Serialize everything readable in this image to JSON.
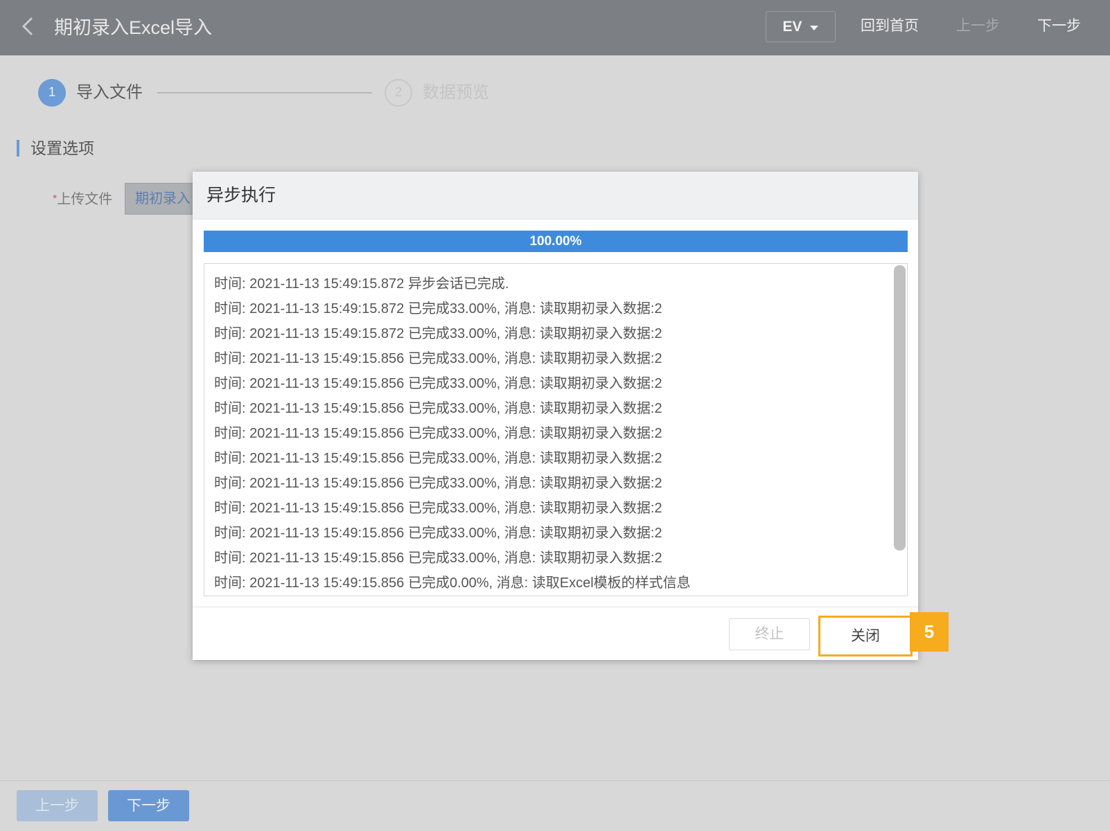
{
  "header": {
    "title": "期初录入Excel导入",
    "scenario_select": "EV",
    "home_label": "回到首页",
    "prev_label": "上一步",
    "next_label": "下一步"
  },
  "steps": [
    {
      "number": "1",
      "label": "导入文件",
      "state": "active"
    },
    {
      "number": "2",
      "label": "数据预览",
      "state": "inactive"
    }
  ],
  "section": {
    "title": "设置选项",
    "upload_required_mark": "*",
    "upload_label": "上传文件",
    "upload_file_value": "期初录入"
  },
  "footer": {
    "prev_label": "上一步",
    "next_label": "下一步"
  },
  "modal": {
    "title": "异步执行",
    "progress_percent": 100,
    "progress_text": "100.00%",
    "log_lines": [
      "时间: 2021-11-13 15:49:15.872 异步会话已完成.",
      "时间: 2021-11-13 15:49:15.872 已完成33.00%, 消息: 读取期初录入数据:2",
      "时间: 2021-11-13 15:49:15.872 已完成33.00%, 消息: 读取期初录入数据:2",
      "时间: 2021-11-13 15:49:15.856 已完成33.00%, 消息: 读取期初录入数据:2",
      "时间: 2021-11-13 15:49:15.856 已完成33.00%, 消息: 读取期初录入数据:2",
      "时间: 2021-11-13 15:49:15.856 已完成33.00%, 消息: 读取期初录入数据:2",
      "时间: 2021-11-13 15:49:15.856 已完成33.00%, 消息: 读取期初录入数据:2",
      "时间: 2021-11-13 15:49:15.856 已完成33.00%, 消息: 读取期初录入数据:2",
      "时间: 2021-11-13 15:49:15.856 已完成33.00%, 消息: 读取期初录入数据:2",
      "时间: 2021-11-13 15:49:15.856 已完成33.00%, 消息: 读取期初录入数据:2",
      "时间: 2021-11-13 15:49:15.856 已完成33.00%, 消息: 读取期初录入数据:2",
      "时间: 2021-11-13 15:49:15.856 已完成33.00%, 消息: 读取期初录入数据:2",
      "时间: 2021-11-13 15:49:15.856 已完成0.00%, 消息: 读取Excel模板的样式信息"
    ],
    "stop_label": "终止",
    "close_label": "关闭",
    "callout_number": "5"
  },
  "colors": {
    "header_bg": "#7c7f83",
    "accent_blue": "#3e8bde",
    "step_active": "#6c9bd5",
    "callout_orange": "#f6ac1c"
  },
  "icons": {
    "back": "chevron-left-icon",
    "dropdown": "caret-down-icon"
  }
}
